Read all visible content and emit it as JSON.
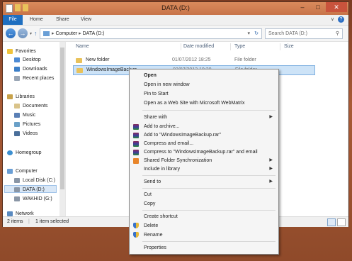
{
  "window": {
    "title": "DATA (D:)"
  },
  "ribbon": {
    "tabs": [
      "File",
      "Home",
      "Share",
      "View"
    ]
  },
  "address": {
    "root": "Computer",
    "current": "DATA (D:)"
  },
  "search": {
    "placeholder": "Search DATA (D:)"
  },
  "nav": {
    "favorites_label": "Favorites",
    "favorites": [
      "Desktop",
      "Downloads",
      "Recent places"
    ],
    "libraries_label": "Libraries",
    "libraries": [
      "Documents",
      "Music",
      "Pictures",
      "Videos"
    ],
    "homegroup_label": "Homegroup",
    "computer_label": "Computer",
    "drives": [
      "Local Disk (C:)",
      "DATA (D:)",
      "WAKHID (G:)"
    ],
    "network_label": "Network"
  },
  "columns": {
    "name": "Name",
    "date": "Date modified",
    "type": "Type",
    "size": "Size"
  },
  "files": [
    {
      "name": "New folder",
      "date": "01/07/2012 18:25",
      "type": "File folder"
    },
    {
      "name": "WindowsImageBackup",
      "date": "02/07/2012 10:30",
      "type": "File folder"
    }
  ],
  "status": {
    "count": "2 items",
    "selected": "1 item selected"
  },
  "context_menu": {
    "open": "Open",
    "open_new_window": "Open in new window",
    "pin_to_start": "Pin to Start",
    "open_webmatrix": "Open as a Web Site with Microsoft WebMatrix",
    "share_with": "Share with",
    "add_to_archive": "Add to archive...",
    "add_to_rar": "Add to \"WindowsImageBackup.rar\"",
    "compress_email": "Compress and email...",
    "compress_rar_email": "Compress to \"WindowsImageBackup.rar\" and email",
    "shared_folder_sync": "Shared Folder Synchronization",
    "include_in_library": "Include in library",
    "send_to": "Send to",
    "cut": "Cut",
    "copy": "Copy",
    "create_shortcut": "Create shortcut",
    "delete": "Delete",
    "rename": "Rename",
    "properties": "Properties"
  },
  "colors": {
    "file_tab": "#1f6fc0",
    "selection": "#cde3f7",
    "title_bar": "#c8744a",
    "close_button": "#c9533c"
  }
}
